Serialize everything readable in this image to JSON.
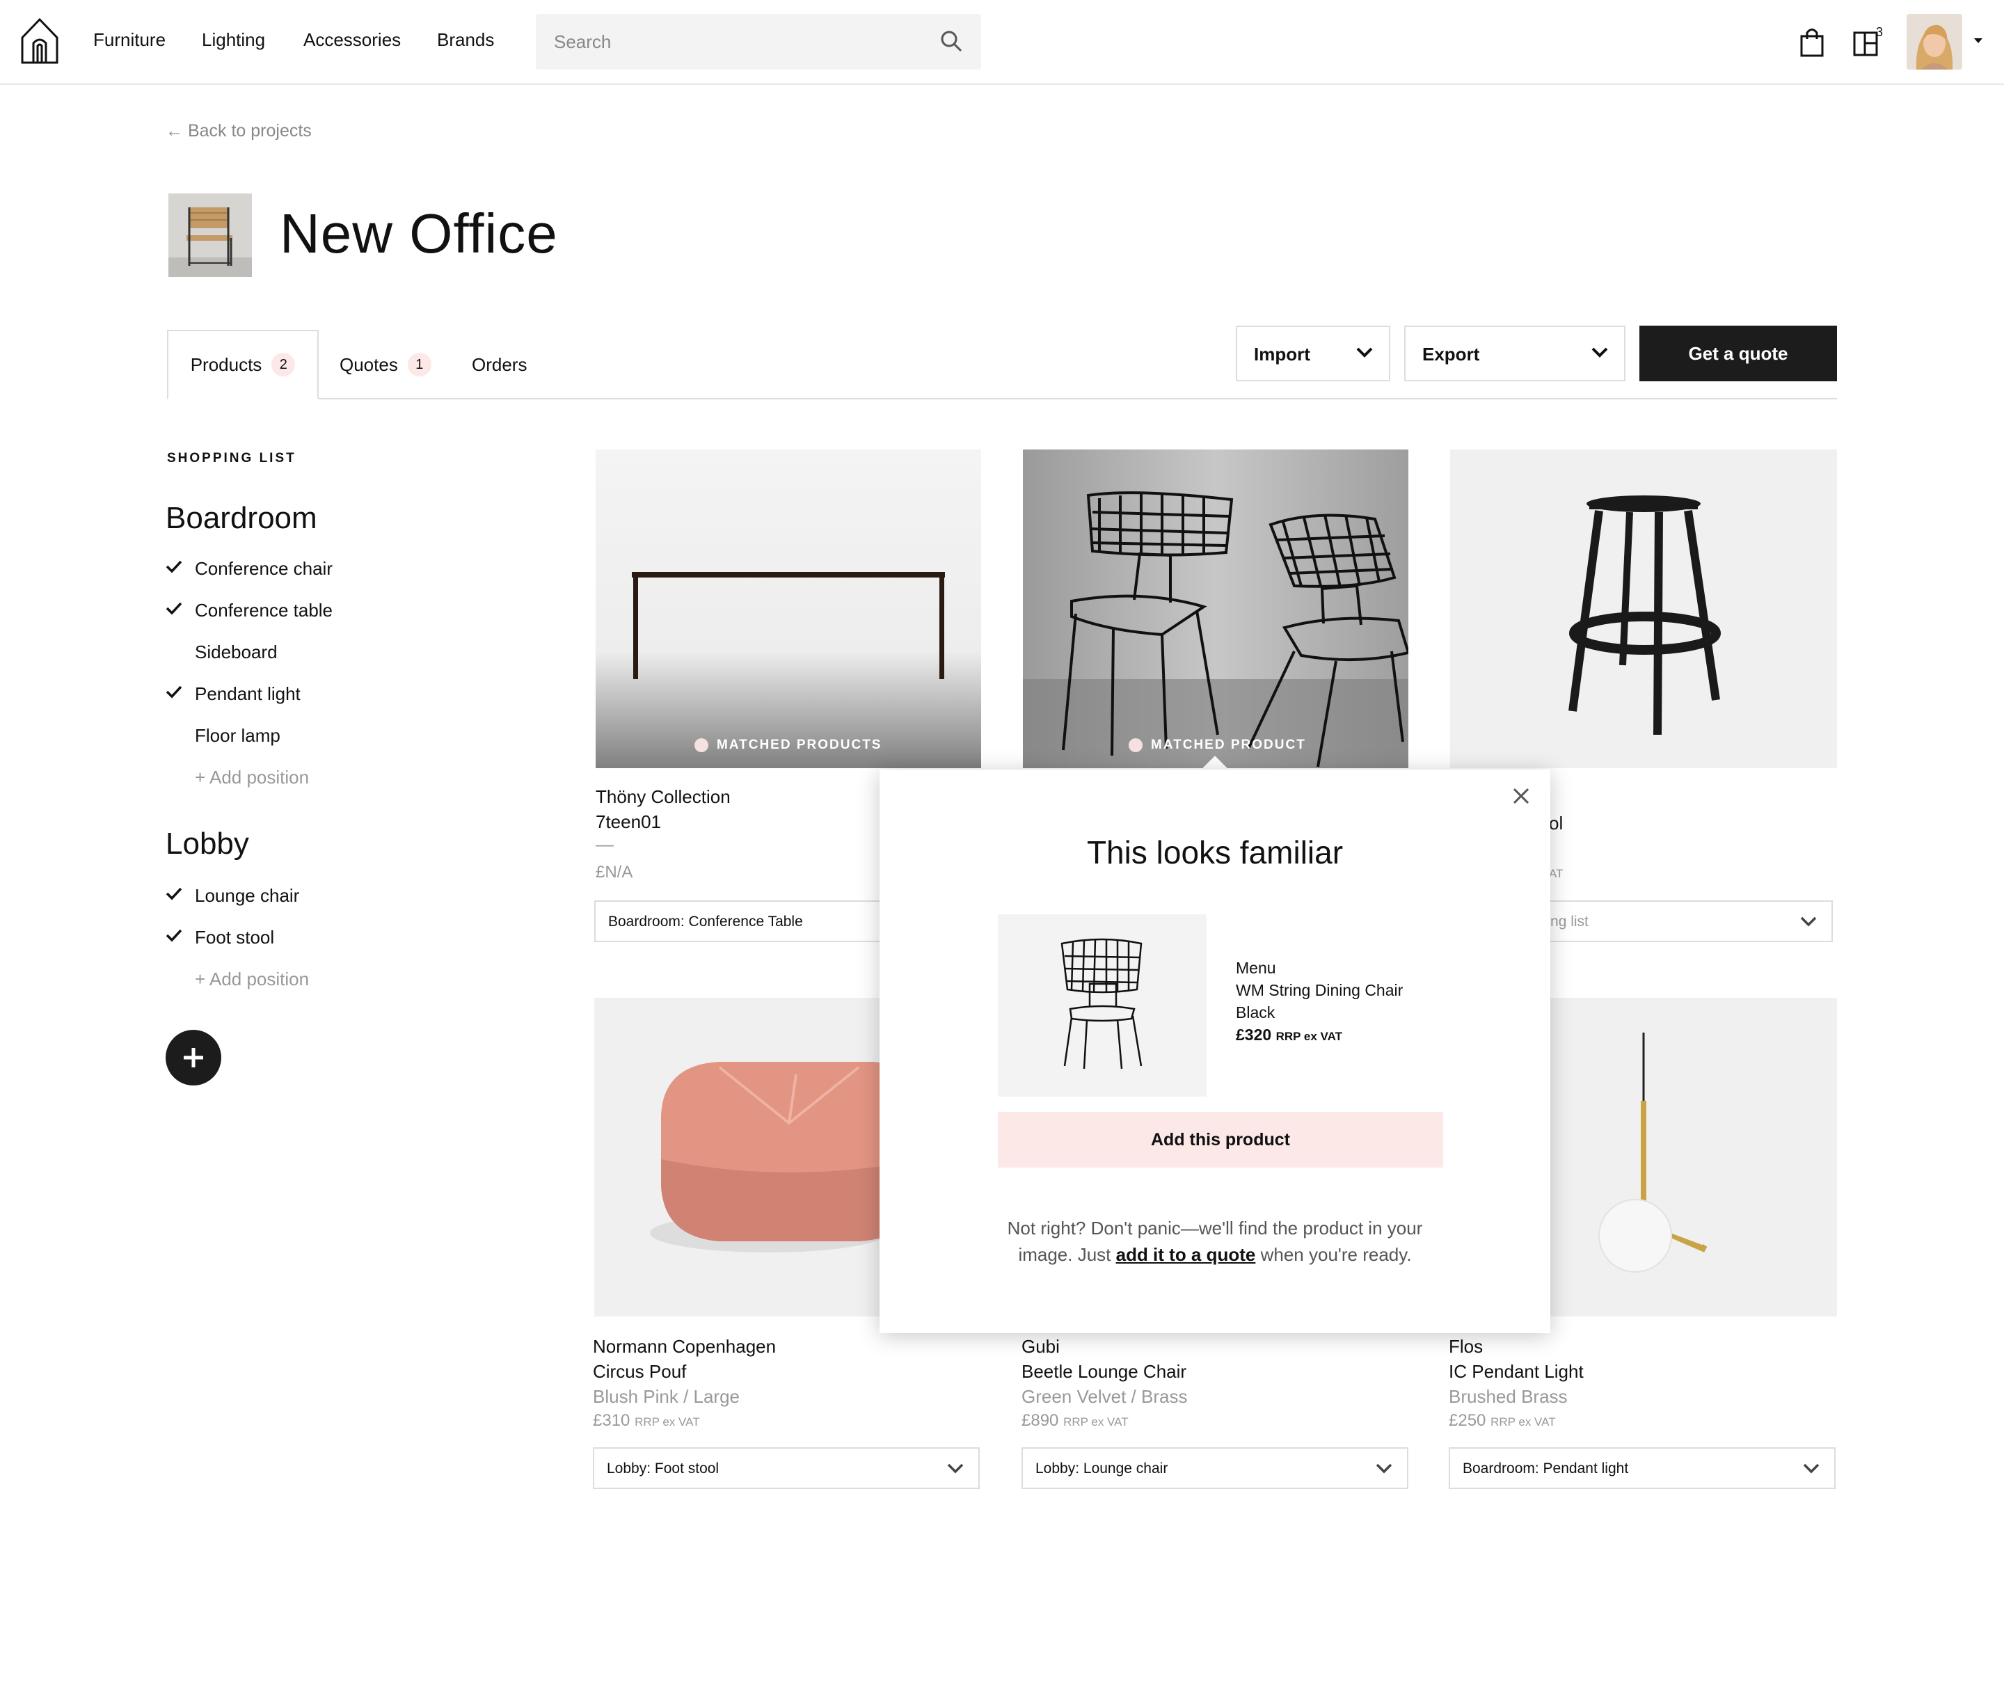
{
  "nav": {
    "links": [
      "Furniture",
      "Lighting",
      "Accessories",
      "Brands"
    ],
    "search_placeholder": "Search",
    "project_count": "3"
  },
  "page": {
    "back_link": "← Back to projects",
    "title": "New Office"
  },
  "tabs": [
    {
      "label": "Products",
      "count": "2"
    },
    {
      "label": "Quotes",
      "count": "1"
    },
    {
      "label": "Orders",
      "count": ""
    }
  ],
  "actions": {
    "import_label": "Import",
    "export_label": "Export",
    "quote_label": "Get a quote"
  },
  "sidebar": {
    "section_label": "SHOPPING LIST",
    "groups": [
      {
        "title": "Boardroom",
        "items": [
          {
            "label": "Conference chair",
            "checked": true
          },
          {
            "label": "Conference table",
            "checked": true
          },
          {
            "label": "Sideboard",
            "checked": false
          },
          {
            "label": "Pendant light",
            "checked": true
          },
          {
            "label": "Floor lamp",
            "checked": false
          }
        ],
        "add_label": "+ Add position"
      },
      {
        "title": "Lobby",
        "items": [
          {
            "label": "Lounge chair",
            "checked": true
          },
          {
            "label": "Foot stool",
            "checked": true
          }
        ],
        "add_label": "+  Add position"
      }
    ]
  },
  "cards": [
    {
      "tag": "MATCHED PRODUCTS",
      "brand": "Thöny Collection",
      "name": "7teen01",
      "variant": "—",
      "price": "£N/A",
      "price_note": "",
      "select": "Boardroom: Conference Table"
    },
    {
      "tag": "MATCHED PRODUCT"
    },
    {
      "brand": "",
      "name": "ol",
      "variant": "",
      "price": "AT",
      "price_note": "",
      "select": "pping list"
    },
    {
      "brand": "Normann Copenhagen",
      "name": "Circus Pouf",
      "variant": "Blush Pink / Large",
      "price": "£310",
      "price_note": "RRP ex VAT",
      "select": "Lobby: Foot stool"
    },
    {
      "brand": "Gubi",
      "name": "Beetle Lounge Chair",
      "variant": "Green Velvet / Brass",
      "price": "£890",
      "price_note": "RRP ex VAT",
      "select": "Lobby: Lounge chair"
    },
    {
      "brand": "Flos",
      "name": "IC Pendant Light",
      "variant": "Brushed Brass",
      "price": "£250",
      "price_note": "RRP ex VAT",
      "select": "Boardroom: Pendant light"
    }
  ],
  "popup": {
    "title": "This looks familiar",
    "brand": "Menu",
    "name": "WM String Dining Chair",
    "variant": "Black",
    "price": "£320",
    "price_note": "RRP ex VAT",
    "add_label": "Add this product",
    "note_before": "Not right? Don't panic—we'll find the product in your image. Just ",
    "note_link": "add it to a quote",
    "note_after": " when you're ready."
  },
  "colors": {
    "accent_pink": "#fde8e8",
    "dark_button": "#1c1c1c"
  }
}
